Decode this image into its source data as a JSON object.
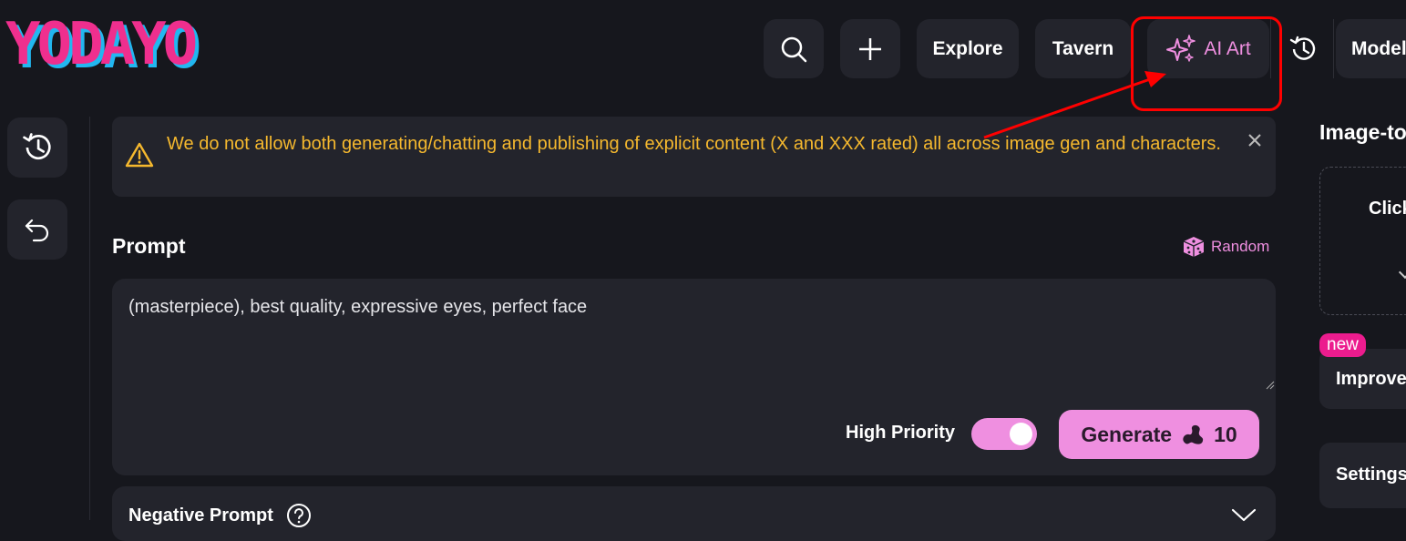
{
  "brand": {
    "logo_text": "YODAYO"
  },
  "topnav": {
    "explore": "Explore",
    "tavern": "Tavern",
    "ai_art": "AI Art",
    "models": "Models"
  },
  "alert": {
    "message": "We do not allow both generating/chatting and publishing of explicit content (X and XXX rated) all across image gen and characters."
  },
  "prompt": {
    "title": "Prompt",
    "random_label": "Random",
    "value": "(masterpiece), best quality, expressive eyes, perfect face",
    "high_priority_label": "High Priority",
    "high_priority_on": true,
    "generate_label": "Generate",
    "generate_cost": "10"
  },
  "negative_prompt": {
    "title": "Negative Prompt"
  },
  "right_panel": {
    "title": "Image-to-Image",
    "dropzone_text": "Click",
    "badge": "new",
    "improve_label": "Improve",
    "settings_label": "Settings"
  },
  "colors": {
    "accent": "#ef8fe0",
    "warning": "#f5b82e",
    "badge": "#ec1c8e",
    "highlight": "#ff0000"
  }
}
